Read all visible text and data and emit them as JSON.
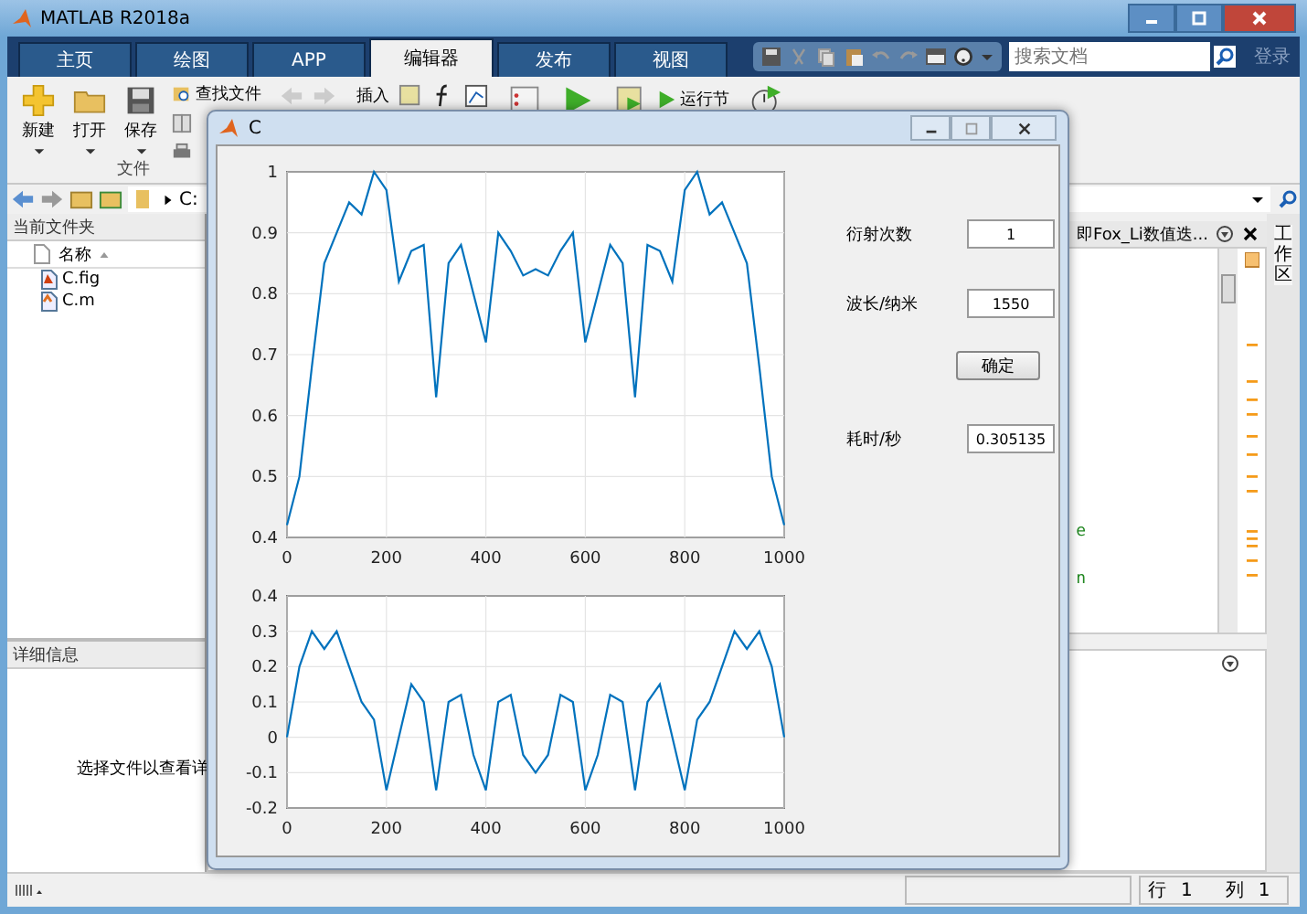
{
  "window": {
    "title": "MATLAB R2018a"
  },
  "tabs": [
    {
      "label": "主页",
      "selected": false
    },
    {
      "label": "绘图",
      "selected": false
    },
    {
      "label": "APP",
      "selected": false
    },
    {
      "label": "编辑器",
      "selected": true
    },
    {
      "label": "发布",
      "selected": false
    },
    {
      "label": "视图",
      "selected": false
    }
  ],
  "search": {
    "placeholder": "搜索文档"
  },
  "login": "登录",
  "toolstrip": {
    "buttons": [
      {
        "label": "新建",
        "kind": "new"
      },
      {
        "label": "打开",
        "kind": "open"
      },
      {
        "label": "保存",
        "kind": "save"
      }
    ],
    "small_buttons": [
      {
        "label": "查找文件",
        "kind": "find"
      },
      {
        "kind": "compare"
      },
      {
        "kind": "print"
      }
    ],
    "insert": "插入",
    "run_section": "运行节",
    "group_label": "文件"
  },
  "path_bar": {
    "segments": [
      "C:"
    ]
  },
  "current_folder": {
    "title": "当前文件夹",
    "column": "名称",
    "files": [
      {
        "name": "C.fig",
        "kind": "fig"
      },
      {
        "name": "C.m",
        "kind": "m"
      }
    ]
  },
  "details": {
    "title": "详细信息",
    "message": "选择文件以查看详"
  },
  "editor": {
    "tab_title": "即Fox_Li数值迭...",
    "lines": [
      "e",
      "n"
    ]
  },
  "side_tab": "工作区",
  "status_bar": {
    "row_label": "行",
    "row": "1",
    "col_label": "列",
    "col": "1"
  },
  "figure": {
    "title": "C",
    "plots": [
      {
        "chart_data": {
          "type": "line",
          "x": [
            0,
            25,
            50,
            75,
            100,
            125,
            150,
            175,
            200,
            225,
            250,
            275,
            300,
            325,
            350,
            375,
            400,
            425,
            450,
            475,
            500,
            525,
            550,
            575,
            600,
            625,
            650,
            675,
            700,
            725,
            750,
            775,
            800,
            825,
            850,
            875,
            900,
            925,
            950,
            975,
            1000
          ],
          "grid": true,
          "series": [
            {
              "color": "#0072bd",
              "values": [
                0.42,
                0.5,
                0.68,
                0.85,
                0.9,
                0.95,
                0.93,
                1.0,
                0.97,
                0.82,
                0.87,
                0.88,
                0.63,
                0.85,
                0.88,
                0.8,
                0.72,
                0.9,
                0.87,
                0.83,
                0.84,
                0.83,
                0.87,
                0.9,
                0.72,
                0.8,
                0.88,
                0.85,
                0.63,
                0.88,
                0.87,
                0.82,
                0.97,
                1.0,
                0.93,
                0.95,
                0.9,
                0.85,
                0.68,
                0.5,
                0.42
              ]
            }
          ],
          "xlim": [
            0,
            1000
          ],
          "ylim": [
            0.4,
            1
          ],
          "xticks": [
            0,
            200,
            400,
            600,
            800,
            1000
          ],
          "yticks": [
            0.4,
            0.5,
            0.6,
            0.7,
            0.8,
            0.9,
            1
          ]
        }
      },
      {
        "chart_data": {
          "type": "line",
          "x": [
            0,
            25,
            50,
            75,
            100,
            125,
            150,
            175,
            200,
            225,
            250,
            275,
            300,
            325,
            350,
            375,
            400,
            425,
            450,
            475,
            500,
            525,
            550,
            575,
            600,
            625,
            650,
            675,
            700,
            725,
            750,
            775,
            800,
            825,
            850,
            875,
            900,
            925,
            950,
            975,
            1000
          ],
          "grid": true,
          "series": [
            {
              "color": "#0072bd",
              "values": [
                0.0,
                0.2,
                0.3,
                0.25,
                0.3,
                0.2,
                0.1,
                0.05,
                -0.15,
                0.0,
                0.15,
                0.1,
                -0.15,
                0.1,
                0.12,
                -0.05,
                -0.15,
                0.1,
                0.12,
                -0.05,
                -0.1,
                -0.05,
                0.12,
                0.1,
                -0.15,
                -0.05,
                0.12,
                0.1,
                -0.15,
                0.1,
                0.15,
                0.0,
                -0.15,
                0.05,
                0.1,
                0.2,
                0.3,
                0.25,
                0.3,
                0.2,
                0.0
              ]
            }
          ],
          "xlim": [
            0,
            1000
          ],
          "ylim": [
            -0.2,
            0.4
          ],
          "xticks": [
            0,
            200,
            400,
            600,
            800,
            1000
          ],
          "yticks": [
            -0.2,
            -0.1,
            0,
            0.1,
            0.2,
            0.3,
            0.4
          ]
        }
      }
    ],
    "fields": [
      {
        "label": "衍射次数",
        "value": "1"
      },
      {
        "label": "波长/纳米",
        "value": "1550"
      }
    ],
    "button": "确定",
    "time": {
      "label": "耗时/秒",
      "value": "0.305135"
    }
  }
}
